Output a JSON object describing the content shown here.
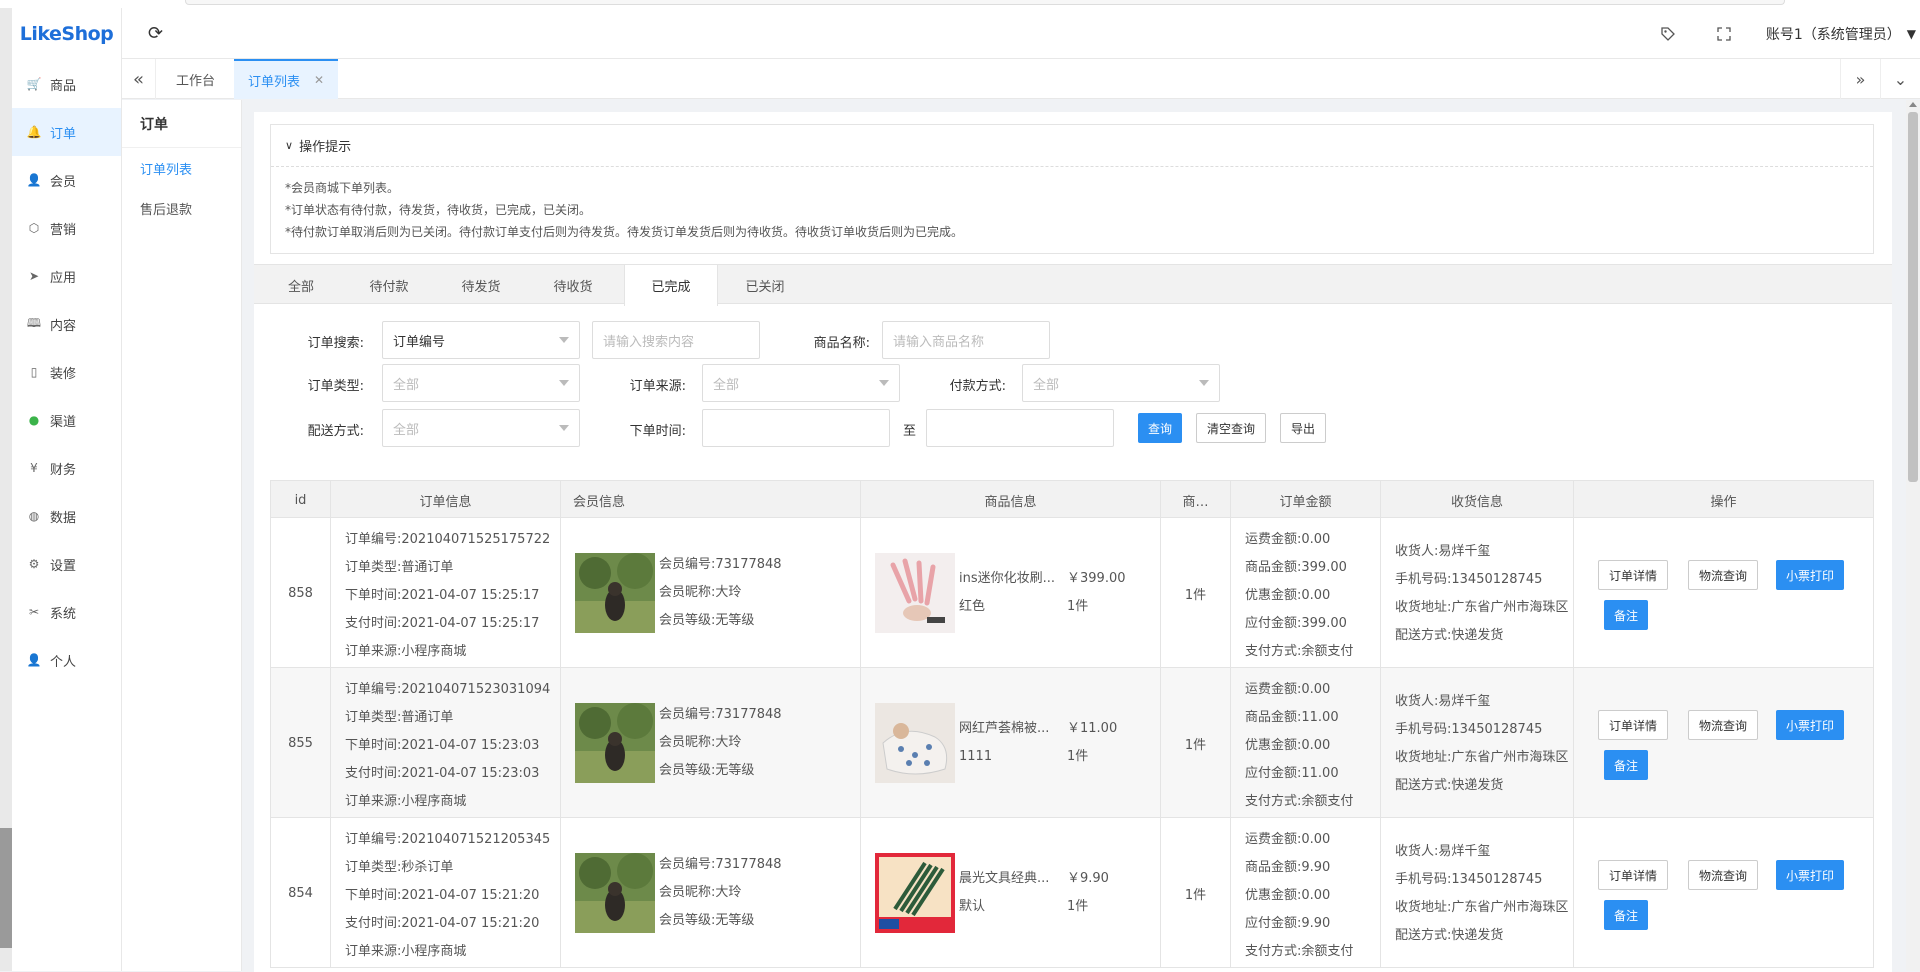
{
  "logo": "LikeShop",
  "header": {
    "account": "账号1（系统管理员）"
  },
  "sidebar": {
    "items": [
      {
        "label": "商品",
        "icon": "cart-icon"
      },
      {
        "label": "订单",
        "icon": "bell-icon"
      },
      {
        "label": "会员",
        "icon": "user-icon"
      },
      {
        "label": "营销",
        "icon": "box-icon"
      },
      {
        "label": "应用",
        "icon": "send-icon"
      },
      {
        "label": "内容",
        "icon": "book-icon"
      },
      {
        "label": "装修",
        "icon": "tablet-icon"
      },
      {
        "label": "渠道",
        "icon": "wechat-icon"
      },
      {
        "label": "财务",
        "icon": "yen-icon"
      },
      {
        "label": "数据",
        "icon": "globe-icon"
      },
      {
        "label": "设置",
        "icon": "gear-icon"
      },
      {
        "label": "系统",
        "icon": "tools-icon"
      },
      {
        "label": "个人",
        "icon": "person-icon"
      }
    ]
  },
  "tabs": {
    "workbench": "工作台",
    "order_list": "订单列表"
  },
  "subside": {
    "title": "订单",
    "items": [
      "订单列表",
      "售后退款"
    ]
  },
  "tips": {
    "title": "操作提示",
    "lines": [
      "*会员商城下单列表。",
      "*订单状态有待付款，待发货，待收货，已完成，已关闭。",
      "*待付款订单取消后则为已关闭。待付款订单支付后则为待发货。待发货订单发货后则为待收货。待收货订单收货后则为已完成。"
    ]
  },
  "status_tabs": [
    "全部",
    "待付款",
    "待发货",
    "待收货",
    "已完成",
    "已关闭"
  ],
  "form": {
    "order_search_label": "订单搜索:",
    "order_search_value": "订单编号",
    "search_placeholder": "请输入搜索内容",
    "goods_name_label": "商品名称:",
    "goods_name_placeholder": "请输入商品名称",
    "order_type_label": "订单类型:",
    "order_type_value": "全部",
    "order_source_label": "订单来源:",
    "order_source_value": "全部",
    "pay_method_label": "付款方式:",
    "pay_method_value": "全部",
    "delivery_label": "配送方式:",
    "delivery_value": "全部",
    "order_time_label": "下单时间:",
    "to": "至",
    "query": "查询",
    "clear": "清空查询",
    "export": "导出"
  },
  "table": {
    "headers": [
      "id",
      "订单信息",
      "会员信息",
      "商品信息",
      "商…",
      "订单金额",
      "收货信息",
      "操作"
    ],
    "rows": [
      {
        "id": "858",
        "order": [
          "订单编号:202104071525175722",
          "订单类型:普通订单",
          "下单时间:2021-04-07 15:25:17",
          "支付时间:2021-04-07 15:25:17",
          "订单来源:小程序商城"
        ],
        "member": [
          "会员编号:73177848",
          "会员昵称:大玲",
          "会员等级:无等级"
        ],
        "goods_name": "ins迷你化妆刷...",
        "goods_spec": "红色",
        "goods_price": "￥399.00",
        "goods_qty": "1件",
        "count": "1件",
        "amount": [
          "运费金额:0.00",
          "商品金额:399.00",
          "优惠金额:0.00",
          "应付金额:399.00",
          "支付方式:余额支付"
        ],
        "recv": [
          "收货人:易烊千玺",
          "手机号码:13450128745",
          "收货地址:广东省广州市海珠区",
          "配送方式:快递发货"
        ]
      },
      {
        "id": "855",
        "order": [
          "订单编号:202104071523031094",
          "订单类型:普通订单",
          "下单时间:2021-04-07 15:23:03",
          "支付时间:2021-04-07 15:23:03",
          "订单来源:小程序商城"
        ],
        "member": [
          "会员编号:73177848",
          "会员昵称:大玲",
          "会员等级:无等级"
        ],
        "goods_name": "网红芦荟棉被...",
        "goods_spec": "1111",
        "goods_price": "￥11.00",
        "goods_qty": "1件",
        "count": "1件",
        "amount": [
          "运费金额:0.00",
          "商品金额:11.00",
          "优惠金额:0.00",
          "应付金额:11.00",
          "支付方式:余额支付"
        ],
        "recv": [
          "收货人:易烊千玺",
          "手机号码:13450128745",
          "收货地址:广东省广州市海珠区",
          "配送方式:快递发货"
        ]
      },
      {
        "id": "854",
        "order": [
          "订单编号:202104071521205345",
          "订单类型:秒杀订单",
          "下单时间:2021-04-07 15:21:20",
          "支付时间:2021-04-07 15:21:20",
          "订单来源:小程序商城"
        ],
        "member": [
          "会员编号:73177848",
          "会员昵称:大玲",
          "会员等级:无等级"
        ],
        "goods_name": "晨光文具经典...",
        "goods_spec": "默认",
        "goods_price": "￥9.90",
        "goods_qty": "1件",
        "count": "1件",
        "amount": [
          "运费金额:0.00",
          "商品金额:9.90",
          "优惠金额:0.00",
          "应付金额:9.90",
          "支付方式:余额支付"
        ],
        "recv": [
          "收货人:易烊千玺",
          "手机号码:13450128745",
          "收货地址:广东省广州市海珠区",
          "配送方式:快递发货"
        ]
      }
    ],
    "ops": {
      "detail": "订单详情",
      "logistics": "物流查询",
      "print": "小票打印",
      "remark": "备注"
    }
  }
}
